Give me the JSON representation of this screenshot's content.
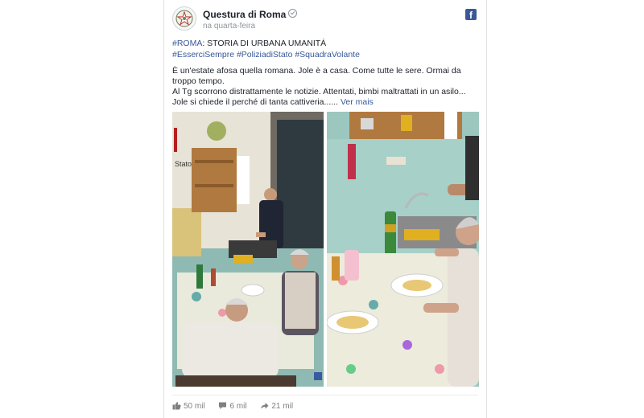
{
  "post": {
    "page_name": "Questura di Roma",
    "timestamp": "na quarta-feira",
    "line1": {
      "tag": "#ROMA",
      "text": ": STORIA DI URBANA UMANITÁ"
    },
    "hashtags": [
      "#EsserciSempre",
      "#PoliziadiStato",
      "#SquadraVolante"
    ],
    "body_line1": "È un'estate afosa quella romana. Jole è a casa. Come tutte le sere. Ormai da troppo tempo.",
    "body_line2": "Al Tg scorrono distrattamente le notizie. Attentati, bimbi maltrattati in un asilo... Jole si chiede il perché di tanta cattiveria......",
    "see_more": "Ver mais"
  },
  "photos": {
    "left_alt": "Kitchen scene: police officer at the stove, elderly couple eating at the table",
    "right_alt": "Elderly woman eating pasta at a floral-covered table",
    "left_sign": "Stato"
  },
  "stats": {
    "likes": "50 mil",
    "comments": "6 mil",
    "shares": "21 mil"
  },
  "colors": {
    "link": "#365899",
    "facebook_blue": "#3b5998",
    "muted": "#90949c"
  },
  "icons": [
    "emblem-icon",
    "verified-icon",
    "facebook-icon",
    "like-icon",
    "comment-icon",
    "share-icon"
  ]
}
